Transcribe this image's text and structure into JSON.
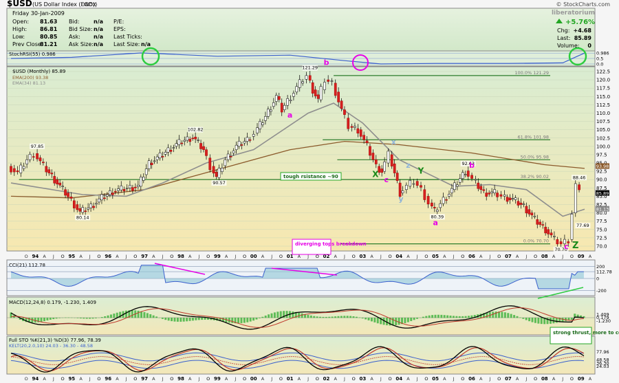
{
  "header": {
    "symbol": "$USD",
    "name": "(US Dollar Index (EOD))",
    "exchange": "INDX",
    "copyright": "© StockCharts.com",
    "watermark": "liberatorium",
    "date": "Friday 30-Jan-2009",
    "left": [
      {
        "label": "Open:",
        "value": "81.63"
      },
      {
        "label": "High:",
        "value": "86.81"
      },
      {
        "label": "Low:",
        "value": "80.85"
      },
      {
        "label": "Prev Close:",
        "value": "81.21"
      }
    ],
    "mid": [
      {
        "label": "Bid:",
        "value": "n/a"
      },
      {
        "label": "Bid Size:",
        "value": "n/a"
      },
      {
        "label": "Ask:",
        "value": "n/a"
      },
      {
        "label": "Ask Size:",
        "value": "n/a"
      }
    ],
    "right": [
      {
        "label": "P/E:",
        "value": ""
      },
      {
        "label": "EPS:",
        "value": ""
      },
      {
        "label": "Last Ticks:",
        "value": ""
      },
      {
        "label": "Last Size:",
        "value": "n/a"
      }
    ],
    "change_pct": "+5.76%",
    "chg_label": "Chg:",
    "chg_value": "+4.68",
    "last_label": "Last:",
    "last_value": "85.89",
    "vol_label": "Volume:",
    "vol_value": "0"
  },
  "stochrsi": {
    "legend": "StochRSI(55) 0.986",
    "ticks": [
      "0.986",
      "0.5",
      "0.0"
    ]
  },
  "price": {
    "legend": "$USD (Monthly) 85.89",
    "ema200": "EMA(200) 93.38",
    "ema34": "EMA(34) 81.13",
    "ticks": [
      "122.5",
      "120.0",
      "117.5",
      "115.0",
      "112.5",
      "110.0",
      "107.5",
      "105.0",
      "102.5",
      "100.0",
      "97.5",
      "95.0",
      "92.5",
      "90.0",
      "87.5",
      "85.0",
      "82.5",
      "80.0",
      "77.5",
      "75.0",
      "72.5",
      "70.0"
    ],
    "right_labels": [
      "93.98",
      "85.89",
      "81.13"
    ]
  },
  "chart_data": {
    "type": "line",
    "title": "$USD (Monthly)",
    "series": [
      {
        "name": "$USD",
        "x": [
          "Jan-94",
          "Jan-95",
          "Jan-96",
          "Jan-97",
          "Jan-98",
          "Jan-99",
          "Jan-00",
          "Jul-01",
          "Jan-02",
          "Jan-03",
          "Jul-03",
          "Jan-04",
          "Jan-05",
          "Nov-05",
          "Jan-06",
          "Jan-07",
          "Jan-08",
          "Jul-08",
          "Nov-08",
          "Jan-09"
        ],
        "values": [
          97.85,
          80.14,
          84.0,
          88.5,
          102.82,
          90.57,
          102.5,
          121.29,
          118.0,
          100.0,
          93.5,
          85.5,
          80.39,
          92.63,
          88.0,
          84.0,
          74.0,
          70.7,
          88.46,
          85.89
        ]
      },
      {
        "name": "EMA(200)",
        "values": [
          85.0,
          84.5,
          85.0,
          87.0,
          92.0,
          95.0,
          100.0,
          101.5,
          102.0,
          102.0,
          101.0,
          99.5,
          98.0,
          97.0,
          96.0,
          95.0,
          94.0,
          93.5,
          93.5,
          93.38
        ]
      },
      {
        "name": "EMA(34)",
        "values": [
          88.0,
          86.0,
          84.5,
          86.0,
          94.0,
          97.0,
          99.0,
          112.0,
          113.0,
          105.0,
          97.0,
          92.5,
          88.0,
          87.0,
          88.0,
          87.0,
          82.0,
          78.5,
          80.0,
          81.13
        ]
      }
    ],
    "ylim": [
      70,
      122.5
    ],
    "price_labels": [
      "121.29",
      "97.85",
      "102.82",
      "90.57",
      "80.14",
      "92.63",
      "80.39",
      "88.46",
      "77.69",
      "70.70"
    ],
    "fib_labels": [
      "100.0% 121.29",
      "61.8% 101.98",
      "50.0% 95.98",
      "38.2% 90.02",
      "0.0% 70.70"
    ],
    "annotations": [
      "b",
      "a",
      "b",
      "X",
      "c",
      "x",
      "z",
      "Y",
      "y",
      "b",
      "a",
      "c",
      "Z",
      "tough rsistance ~90",
      "diverging tops breakdown",
      "strong thrust, more to come"
    ]
  },
  "cci": {
    "legend": "CCI(21) 112.78",
    "ticks": [
      "200",
      "112.78",
      "0",
      "-200"
    ]
  },
  "macd": {
    "legend": "MACD(12,24,8) 0.179, -1.230, 1.409",
    "ticks": [
      "1.409",
      "0.179",
      "-1.230"
    ]
  },
  "sto": {
    "legend": "Full STO %K(21,3) %D(3) 77.96, 78.39",
    "legend2": "KELT(20,2.0,10) 24.03 - 36.30 - 48.58",
    "ticks": [
      "77.96",
      "48.58",
      "36.30",
      "24.03"
    ]
  },
  "time_axis": {
    "years": [
      "94",
      "95",
      "96",
      "97",
      "98",
      "99",
      "00",
      "01",
      "02",
      "03",
      "04",
      "05",
      "06",
      "07",
      "08",
      "09"
    ],
    "months": [
      "A",
      "J",
      "O",
      "A",
      "J",
      "O"
    ]
  },
  "colors": {
    "green": "#23a623",
    "magenta": "#e600e6",
    "fib": "#2c7d2c",
    "blue": "#3a5fcd",
    "ema200": "#8b5a2b",
    "ema34": "#8e8e8e"
  }
}
